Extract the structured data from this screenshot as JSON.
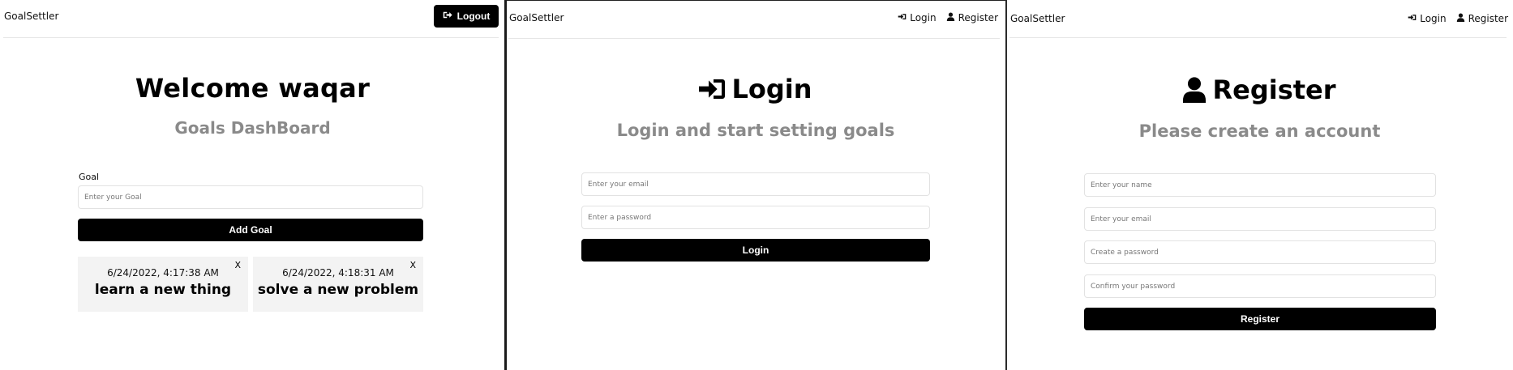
{
  "dashboard": {
    "logo": "GoalSettler",
    "logout_label": "Logout",
    "title": "Welcome waqar",
    "subtitle": "Goals DashBoard",
    "goal_label": "Goal",
    "goal_placeholder": "Enter your Goal",
    "add_button": "Add Goal",
    "goals": [
      {
        "date": "6/24/2022, 4:17:38 AM",
        "text": "learn a new thing",
        "close": "X"
      },
      {
        "date": "6/24/2022, 4:18:31 AM",
        "text": "solve a new problem",
        "close": "X"
      }
    ]
  },
  "login": {
    "logo": "GoalSettler",
    "nav": {
      "login": "Login",
      "register": "Register"
    },
    "title": "Login",
    "subtitle": "Login and start setting goals",
    "email_placeholder": "Enter your email",
    "password_placeholder": "Enter a password",
    "submit": "Login"
  },
  "register": {
    "logo": "GoalSettler",
    "nav": {
      "login": "Login",
      "register": "Register"
    },
    "title": "Register",
    "subtitle": "Please create an account",
    "name_placeholder": "Enter your name",
    "email_placeholder": "Enter your email",
    "password_placeholder": "Create a password",
    "confirm_placeholder": "Confirm your password",
    "submit": "Register"
  },
  "icons": {
    "logout": "sign-out-icon",
    "login": "sign-in-icon",
    "register": "user-icon"
  }
}
